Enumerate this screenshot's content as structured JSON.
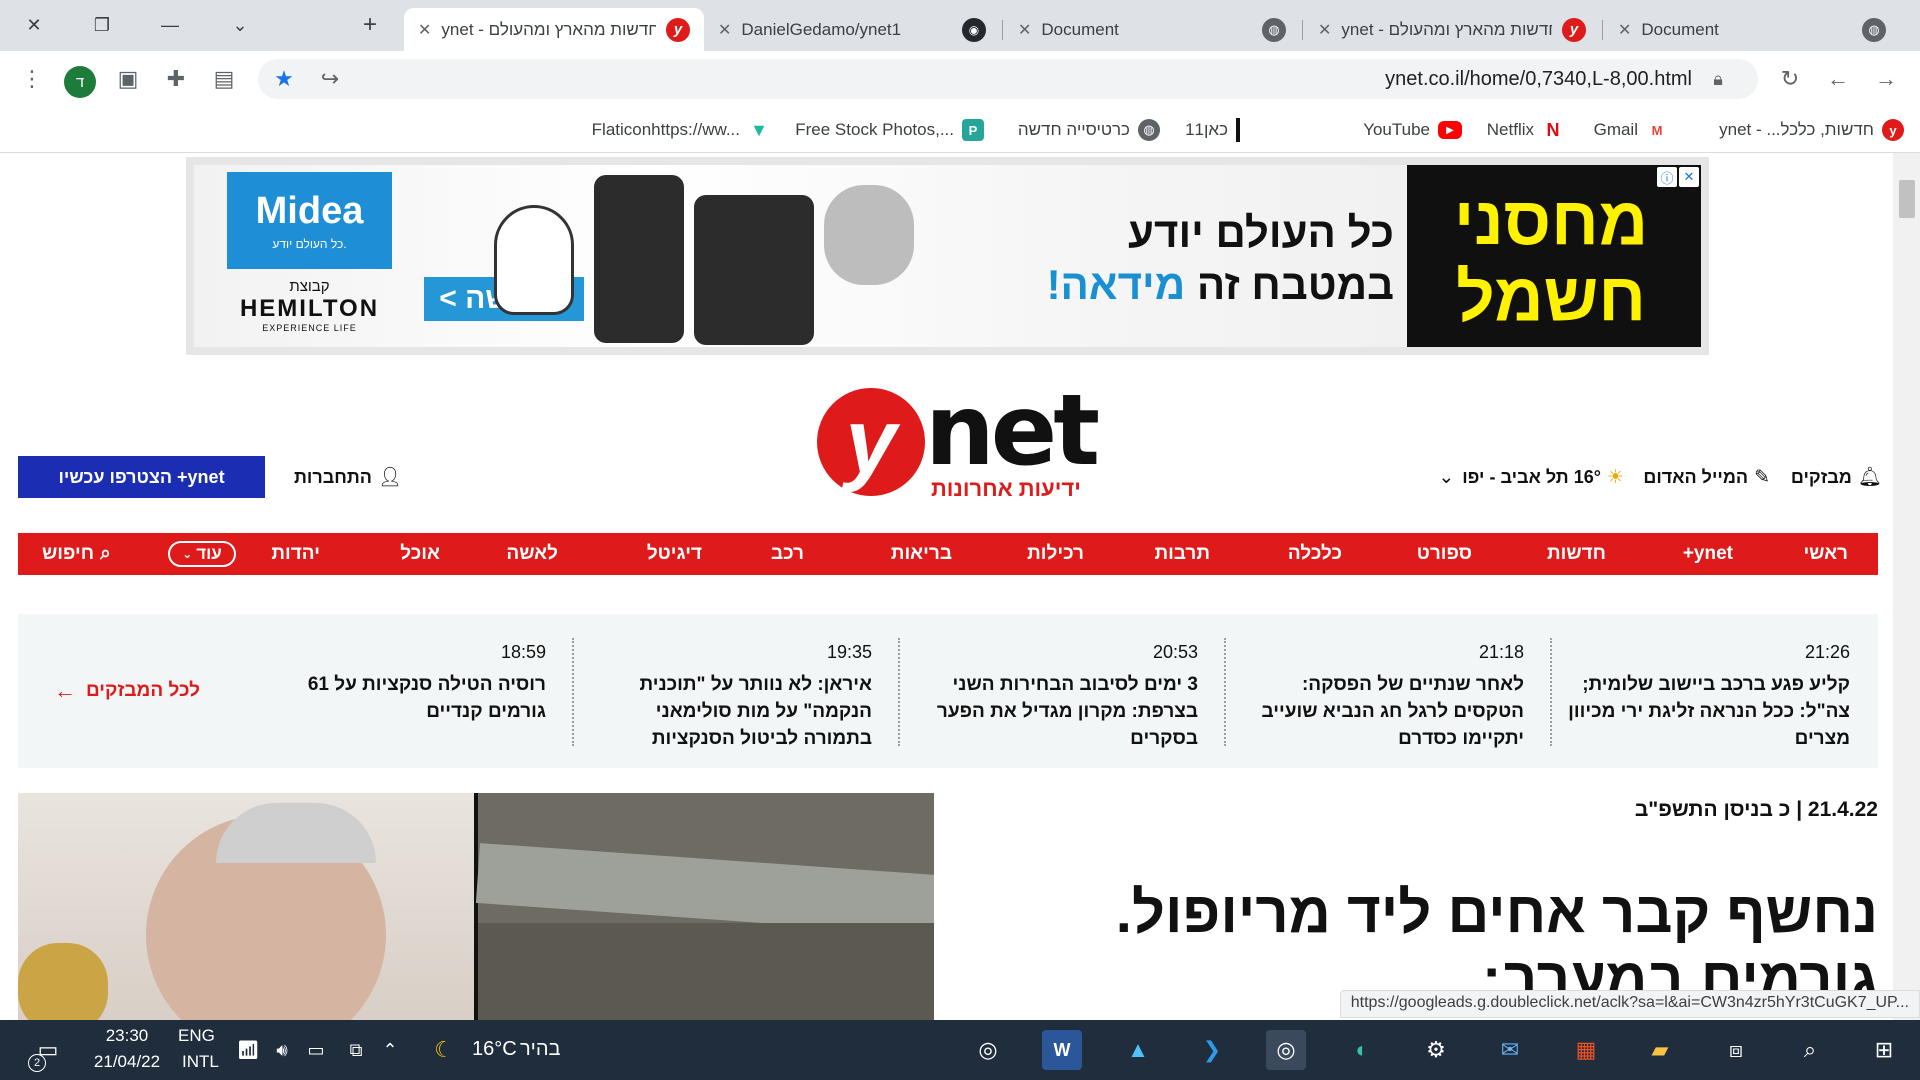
{
  "browser": {
    "tabs": [
      {
        "title": "ynet - חדשות מהארץ ומהעולם",
        "icon": "ynet-favicon"
      },
      {
        "title": "DanielGedamo/ynet1",
        "icon": "github-icon"
      },
      {
        "title": "Document",
        "icon": "globe-icon"
      },
      {
        "title": "ynet - חדשות מהארץ ומהעולם",
        "icon": "ynet-favicon"
      },
      {
        "title": "Document",
        "icon": "globe-icon"
      }
    ],
    "url": "ynet.co.il/home/0,7340,L-8,00.html",
    "profile_initial": "ד",
    "bookmarks": [
      {
        "label": "חדשות, כלכל... - ynet",
        "icon": "ynet-favicon"
      },
      {
        "label": "Gmail",
        "icon": "gmail-icon"
      },
      {
        "label": "Netflix",
        "icon": "netflix-icon"
      },
      {
        "label": "YouTube",
        "icon": "youtube-icon"
      },
      {
        "label": "כאן11",
        "icon": "kan11-icon"
      },
      {
        "label": "כרטיסייה חדשה",
        "icon": "globe-icon"
      },
      {
        "label": "Free Stock Photos,...",
        "icon": "stockphotos-icon"
      },
      {
        "label": "Flaticonhttps://ww...",
        "icon": "flaticon-icon"
      }
    ],
    "status_url": "https://googleads.g.doubleclick.net/aclk?sa=l&ai=CW3n4zr5hYr3tCuGK7_UP..."
  },
  "ad": {
    "brand_big": "מחסני חשמל",
    "copy_line1": "כל העולם יודע",
    "copy_line2_prefix": "במטבח זה",
    "copy_line2_brand": "מידאה!",
    "cta": "לרכישה >",
    "midea_logo": "Midea",
    "midea_tagline": "כל העולם יודע.",
    "group_label": "קבוצת",
    "group_name": "HEMILTON",
    "group_tagline": "EXPERIENCE LIFE"
  },
  "site": {
    "logo_y": "y",
    "logo_net": "net",
    "logo_sub": "ידיעות אחרונות",
    "header": {
      "breaking": "מבזקים",
      "red_mail": "המייל האדום",
      "weather": "16° תל אביב - יפו",
      "login": "התחברות",
      "join": "ynet+ הצטרפו עכשיו"
    },
    "nav": [
      "ראשי",
      "ynet+",
      "חדשות",
      "ספורט",
      "כלכלה",
      "תרבות",
      "רכילות",
      "בריאות",
      "רכב",
      "דיגיטל",
      "לאשה",
      "אוכל",
      "יהדות"
    ],
    "nav_more": "עוד",
    "nav_search": "חיפוש",
    "ticker": {
      "all_label": "לכל המבזקים",
      "items": [
        {
          "time": "21:26",
          "title": "קליע פגע ברכב ביישוב שלומית; צה\"ל: ככל הנראה זליגת ירי מכיוון מצרים"
        },
        {
          "time": "21:18",
          "title": "לאחר שנתיים של הפסקה: הטקסים לרגל חג הנביא שועייב יתקיימו כסדרם"
        },
        {
          "time": "20:53",
          "title": "3 ימים לסיבוב הבחירות השני בצרפת: מקרון מגדיל את הפער בסקרים"
        },
        {
          "time": "19:35",
          "title": "איראן: לא נוותר על \"תוכנית הנקמה\" על מות סולימאני בתמורה לביטול הסנקציות"
        },
        {
          "time": "18:59",
          "title": "רוסיה הטילה סנקציות על 61 גורמים קנדיים"
        }
      ]
    },
    "date_line": "21.4.22 | כ בניסן התשפ\"ב",
    "headline": "נחשף קבר אחים ליד מריופול. גורמים במערב:"
  },
  "taskbar": {
    "time": "23:30",
    "date": "21/04/22",
    "lang": "ENG",
    "lang_sub": "INTL",
    "weather_temp": "16°C",
    "weather_desc": "בהיר",
    "notifications": "2"
  }
}
